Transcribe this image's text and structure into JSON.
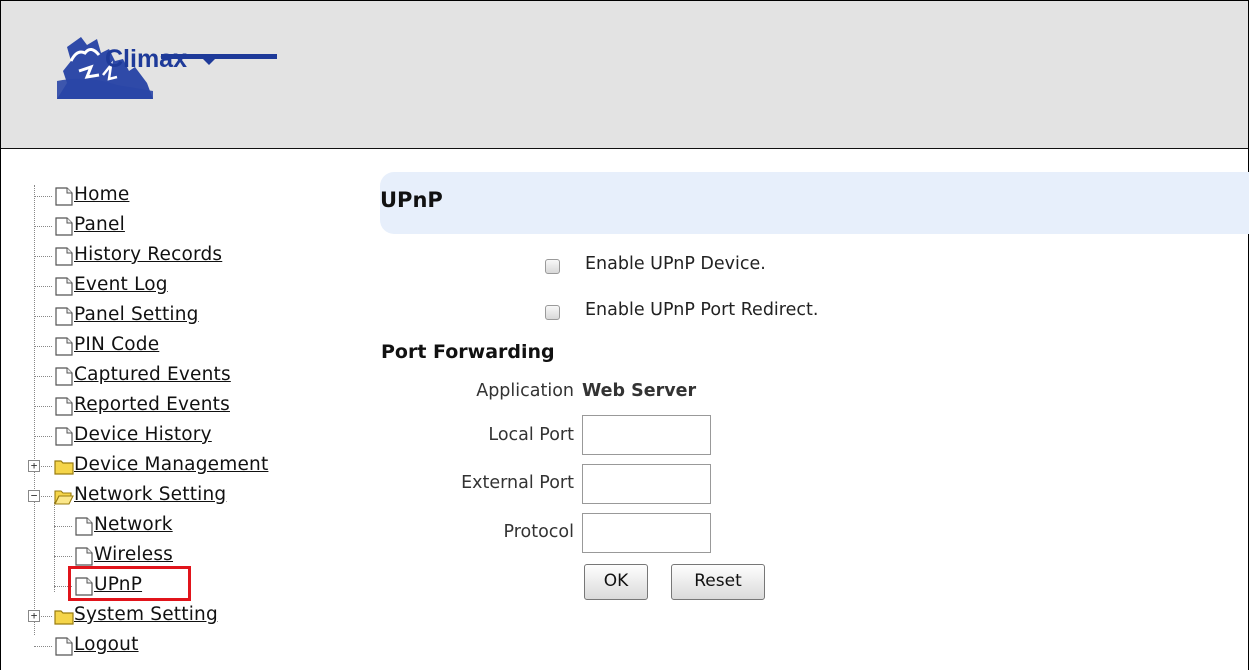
{
  "brand": {
    "name": "Climax"
  },
  "nav": {
    "items": [
      {
        "label": "Home"
      },
      {
        "label": "Panel"
      },
      {
        "label": "History Records"
      },
      {
        "label": "Event Log"
      },
      {
        "label": "Panel Setting"
      },
      {
        "label": "PIN Code"
      },
      {
        "label": "Captured Events"
      },
      {
        "label": "Reported Events"
      },
      {
        "label": "Device History"
      },
      {
        "label": "Device Management"
      },
      {
        "label": "Network Setting"
      },
      {
        "label": "Network"
      },
      {
        "label": "Wireless"
      },
      {
        "label": "UPnP"
      },
      {
        "label": "System Setting"
      },
      {
        "label": "Logout"
      }
    ],
    "expand_symbol": "+",
    "collapse_symbol": "−"
  },
  "page": {
    "title": "UPnP",
    "enable_device_label": "Enable UPnP Device.",
    "enable_redirect_label": "Enable UPnP Port Redirect.",
    "port_forwarding_title": "Port Forwarding",
    "application_label": "Application",
    "application_value": "Web Server",
    "local_port_label": "Local Port",
    "local_port_value": "",
    "external_port_label": "External Port",
    "external_port_value": "",
    "protocol_label": "Protocol",
    "protocol_value": "",
    "ok_label": "OK",
    "reset_label": "Reset",
    "enable_device_checked": false,
    "enable_redirect_checked": false
  },
  "colors": {
    "header_bg": "#e3e3e3",
    "logo_blue": "#1e3a99",
    "title_bar_bg": "#e7effb",
    "highlight_red": "#e1141b",
    "folder_yellow": "#f5d54a"
  }
}
